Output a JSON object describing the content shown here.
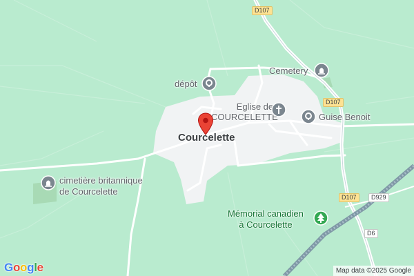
{
  "map": {
    "background_color": "#b9ebcf",
    "town": {
      "name": "Courcelette"
    },
    "pois": {
      "depot": {
        "label": "dépôt",
        "icon": "pin-circle-icon"
      },
      "cemetery": {
        "label": "Cemetery",
        "icon": "cemetery-icon"
      },
      "church": {
        "line1": "Eglise de",
        "line2": "COURCELETTE",
        "icon": "church-cross-icon"
      },
      "guise": {
        "label": "Guise Benoit",
        "icon": "pin-circle-icon"
      },
      "british_cemetery": {
        "line1": "cimetière britannique",
        "line2": "de Courcelette",
        "icon": "cemetery-icon"
      },
      "memorial": {
        "line1": "Mémorial canadien",
        "line2": "à Courcelette",
        "icon": "park-tree-icon"
      }
    },
    "roads": {
      "d107_top": "D107",
      "d107_mid": "D107",
      "d107_low": "D107",
      "d929": "D929",
      "d6": "D6"
    },
    "logo": {
      "text": "Google",
      "letters": [
        "G",
        "o",
        "o",
        "g",
        "l",
        "e"
      ],
      "colors": [
        "#4285F4",
        "#EA4335",
        "#FBBC05",
        "#4285F4",
        "#34A853",
        "#EA4335"
      ]
    },
    "attribution": "Map data ©2025 Google",
    "colors": {
      "town_area": "#f1f3f4",
      "road": "#ffffff",
      "road_minor": "#dadce0",
      "railway": "#8fa7b3",
      "marker": "#ea4335",
      "cemetery_area": "#a8dab5"
    }
  }
}
